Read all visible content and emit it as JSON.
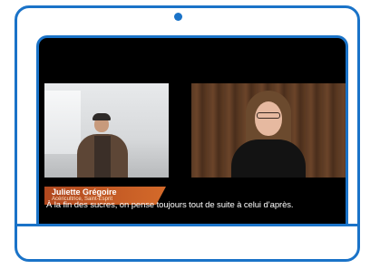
{
  "video": {
    "speaker_name": "Juliette Grégoire",
    "speaker_role": "Acéricultrice, Saint-Esprit",
    "subtitle": "À la fin des sucres, on pense toujours tout de suite à celui d’après."
  },
  "colors": {
    "frame_accent": "#1a73c8",
    "name_plate": "#c8582a",
    "screen_bg": "#000000"
  },
  "icons": {
    "camera": "camera-dot-icon"
  }
}
